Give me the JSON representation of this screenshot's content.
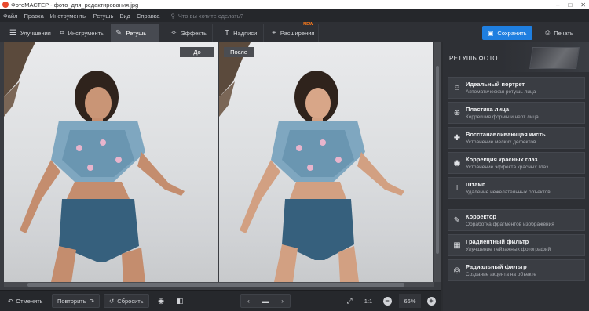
{
  "window": {
    "title": "ФотоМАСТЕР - фото_для_редактирования.jpg"
  },
  "menu": {
    "items": [
      "Файл",
      "Правка",
      "Инструменты",
      "Ретушь",
      "Вид",
      "Справка"
    ],
    "search_placeholder": "Что вы хотите сделать?"
  },
  "tabs": [
    {
      "label": "Улучшения",
      "icon": "sliders-icon"
    },
    {
      "label": "Инструменты",
      "icon": "crop-icon"
    },
    {
      "label": "Ретушь",
      "icon": "brush-icon"
    },
    {
      "label": "Эффекты",
      "icon": "wand-icon"
    },
    {
      "label": "Надписи",
      "icon": "text-icon"
    },
    {
      "label": "Расширения",
      "icon": "plus-icon",
      "badge": "NEW"
    }
  ],
  "actions": {
    "save": "Сохранить",
    "print": "Печать"
  },
  "canvas": {
    "before_label": "До",
    "after_label": "После"
  },
  "panel": {
    "title": "РЕТУШЬ ФОТО",
    "tools": [
      {
        "name": "Идеальный портрет",
        "desc": "Автоматическая ретушь лица",
        "icon": "portrait-icon"
      },
      {
        "name": "Пластика лица",
        "desc": "Коррекция формы и черт лица",
        "icon": "face-icon"
      },
      {
        "name": "Восстанавливающая кисть",
        "desc": "Устранение мелких дефектов",
        "icon": "healing-brush-icon"
      },
      {
        "name": "Коррекция красных глаз",
        "desc": "Устранение эффекта красных глаз",
        "icon": "eye-icon"
      },
      {
        "name": "Штамп",
        "desc": "Удаление нежелательных объектов",
        "icon": "stamp-icon"
      },
      {
        "name": "Корректор",
        "desc": "Обработка фрагментов изображения",
        "icon": "corrector-brush-icon"
      },
      {
        "name": "Градиентный фильтр",
        "desc": "Улучшение пейзажных фотографий",
        "icon": "gradient-icon"
      },
      {
        "name": "Радиальный фильтр",
        "desc": "Создание акцента на объекте",
        "icon": "radial-icon"
      }
    ]
  },
  "status": {
    "undo": "Отменить",
    "redo": "Повторить",
    "reset": "Сбросить",
    "ratio": "1:1",
    "zoom": "66%"
  },
  "colors": {
    "accent": "#1f7fe0",
    "new_badge": "#ff7a1a"
  }
}
